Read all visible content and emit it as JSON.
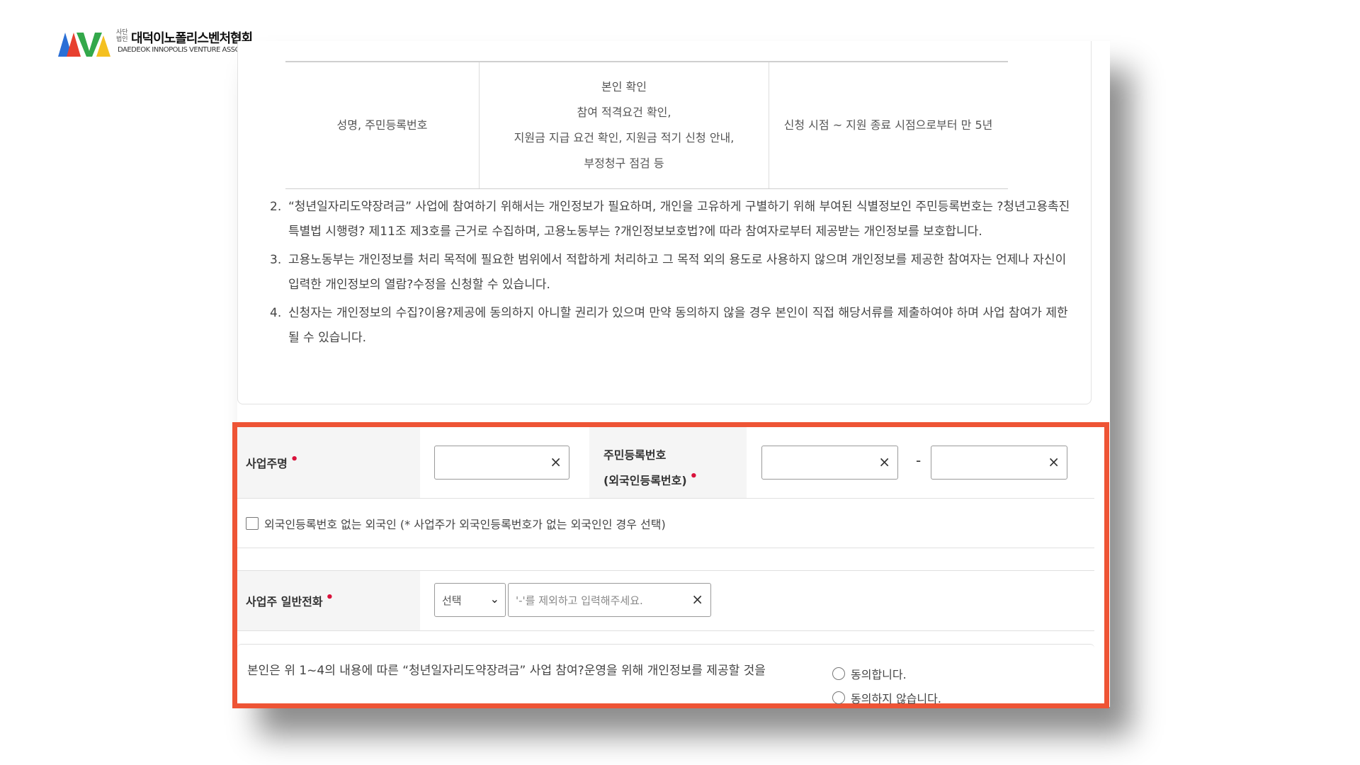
{
  "logo": {
    "small": "사단 법인",
    "name": "대덕이노폴리스벤처협회",
    "english": "DAEDEOK INNOPOLIS VENTURE ASSOCIATION",
    "colors": [
      "#2a6fd6",
      "#e7402f",
      "#33a84a",
      "#f4c020"
    ]
  },
  "purpose_table": {
    "items": "성명, 주민등록번호",
    "purpose_lines": [
      "본인 확인",
      "참여 적격요건 확인,",
      "지원금 지급 요건 확인, 지원금 적기 신청 안내,",
      "부정청구 점검 등"
    ],
    "retention": "신청 시점 ~ 지원 종료 시점으로부터 만 5년"
  },
  "notes": [
    {
      "num": "2.",
      "text": "“청년일자리도약장려금” 사업에 참여하기 위해서는 개인정보가 필요하며, 개인을 고유하게 구별하기 위해 부여된 식별정보인 주민등록번호는 ?청년고용촉진특별법 시행령? 제11조 제3호를 근거로 수집하며, 고용노동부는 ?개인정보보호법?에 따라 참여자로부터 제공받는 개인정보를 보호합니다."
    },
    {
      "num": "3.",
      "text": "고용노동부는 개인정보를 처리 목적에 필요한 범위에서 적합하게 처리하고 그 목적 외의 용도로 사용하지 않으며 개인정보를 제공한 참여자는 언제나 자신이 입력한 개인정보의 열람?수정을 신청할 수 있습니다."
    },
    {
      "num": "4.",
      "text": "신청자는 개인정보의 수집?이용?제공에 동의하지 아니할 권리가 있으며 만약 동의하지 않을 경우 본인이 직접 해당서류를 제출하여야 하며 사업 참여가 제한될 수 있습니다."
    }
  ],
  "form": {
    "owner_name_label": "사업주명",
    "required_mark": "•",
    "rrn_label_1": "주민등록번호",
    "rrn_label_2": "(외국인등록번호)",
    "clear_symbol": "×",
    "dash": "-",
    "foreigner_checkbox_label": "외국인등록번호 없는 외국인 (* 사업주가 외국인등록번호가 없는 외국인인 경우 선택)",
    "phone_label": "사업주 일반전화",
    "phone_select_value": "선택",
    "phone_placeholder": "'-'를 제외하고 입력해주세요.",
    "consent_text": "본인은 위 1~4의 내용에 따른 “청년일자리도약장려금” 사업 참여?운영을 위해 개인정보를 제공할 것을",
    "agree_label": "동의합니다.",
    "disagree_label": "동의하지 않습니다.",
    "highlight_color": "#ee5435"
  }
}
